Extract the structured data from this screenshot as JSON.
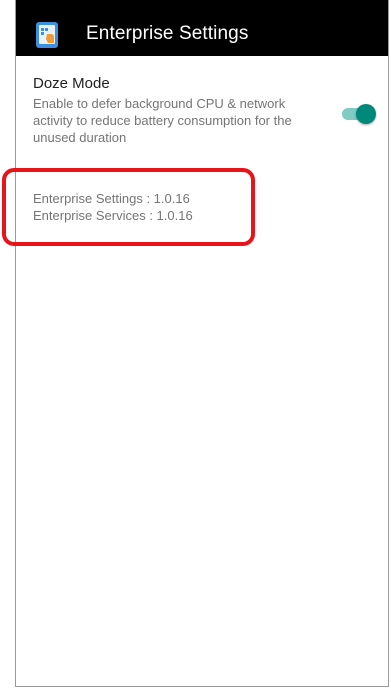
{
  "appbar": {
    "title": "Enterprise Settings",
    "icon": "enterprise-settings-app-icon",
    "background": "#000000"
  },
  "doze": {
    "title": "Doze Mode",
    "summary": "Enable to defer background CPU & network activity to reduce battery consumption for the unused duration",
    "enabled": true,
    "accent": "#00897b"
  },
  "versions": {
    "settings": "Enterprise Settings : 1.0.16",
    "services": "Enterprise Services : 1.0.16"
  },
  "highlight": {
    "color": "#e8141a"
  }
}
